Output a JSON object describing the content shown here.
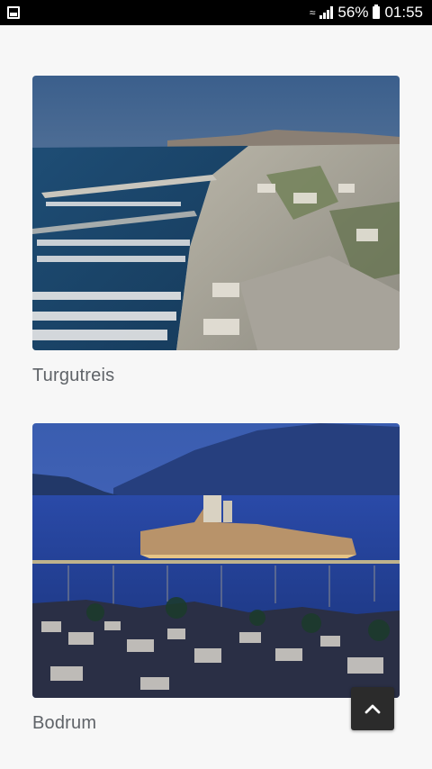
{
  "status_bar": {
    "battery": "56%",
    "time": "01:55"
  },
  "cards": [
    {
      "title": "Turgutreis",
      "image": "aerial-marina-photo"
    },
    {
      "title": "Bodrum",
      "image": "bodrum-castle-night-photo"
    }
  ],
  "icons": {
    "status_left": "gallery-icon",
    "scroll_top": "chevron-up-icon"
  },
  "colors": {
    "status_bar_bg": "#000000",
    "page_bg": "#f7f7f7",
    "title_text": "#5f6368",
    "scroll_button_bg": "#2b2b2b"
  }
}
